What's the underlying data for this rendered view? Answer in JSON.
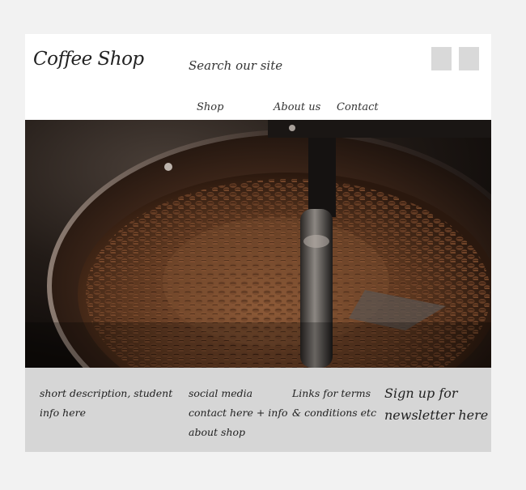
{
  "header": {
    "logo": "Coffee Shop",
    "search_placeholder": "Search our site",
    "icons": [
      "square-icon",
      "square-icon"
    ]
  },
  "nav": {
    "items": [
      "Shop",
      "About us",
      "Contact"
    ]
  },
  "hero": {
    "image_subject": "coffee beans in roaster"
  },
  "footer": {
    "col1": [
      "short description, student",
      "info here"
    ],
    "col2": [
      "social media",
      "contact here + info",
      "about shop"
    ],
    "col3": [
      "Links for terms",
      "& conditions etc"
    ],
    "col4": [
      "Sign up for",
      "newsletter here"
    ]
  },
  "colors": {
    "page_bg": "#f2f2f2",
    "header_bg": "#ffffff",
    "footer_bg": "#d6d6d6",
    "icon_placeholder": "#d9d9d9"
  }
}
